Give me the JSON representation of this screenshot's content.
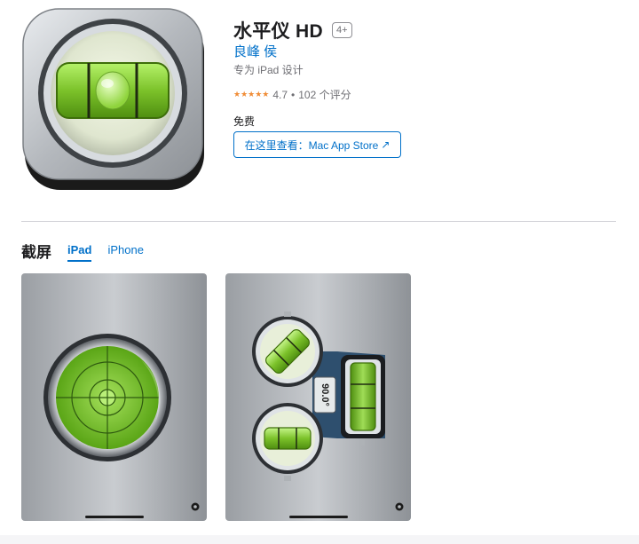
{
  "app": {
    "title": "水平仪 HD",
    "age_rating": "4+",
    "developer": "良峰 侯",
    "designed_for": "专为 iPad 设计",
    "rating_stars": "★★★★★",
    "rating_value": "4.7",
    "rating_separator": "•",
    "rating_count": "102 个评分",
    "price": "免费",
    "mac_store_button": "在这里查看：Mac App Store",
    "mac_store_arrow": "↗"
  },
  "screenshots": {
    "section_title": "截屏",
    "tabs": [
      {
        "label": "iPad",
        "active": true
      },
      {
        "label": "iPhone",
        "active": false
      }
    ],
    "angle_readout": "90.0°"
  },
  "colors": {
    "link": "#0070c9",
    "star": "#f08c36",
    "level_green": "#7cc22a"
  },
  "icons": [
    "bubble-level-app-icon",
    "gear-icon",
    "external-arrow-icon",
    "star-icon"
  ]
}
